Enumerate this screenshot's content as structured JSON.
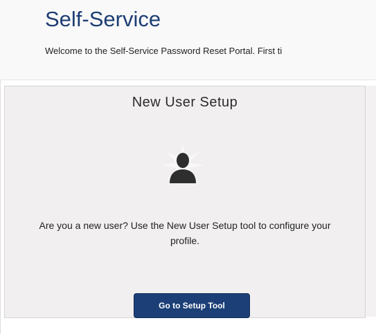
{
  "header": {
    "title": "Self-Service",
    "welcome": "Welcome to the Self-Service Password Reset Portal. First ti"
  },
  "new_user_panel": {
    "title": "New User Setup",
    "icon": "user-silhouette-icon",
    "description": "Are you a new user? Use the New User Setup tool to configure your profile.",
    "button_label": "Go to Setup Tool"
  },
  "colors": {
    "title": "#1d3e73",
    "button": "#1c3f77",
    "panel_bg": "#f1efef"
  }
}
